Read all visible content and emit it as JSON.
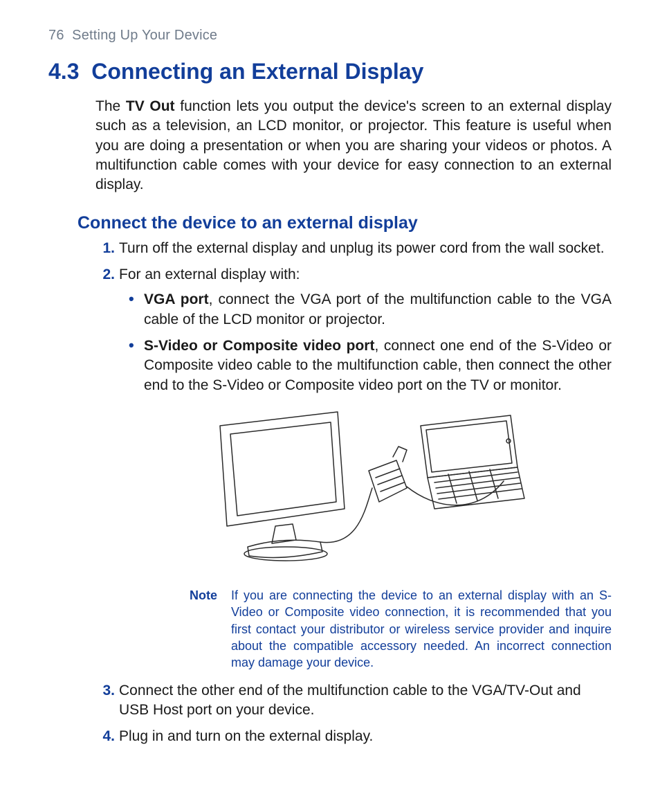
{
  "page_number": "76",
  "chapter_title": "Setting Up Your Device",
  "section_number": "4.3",
  "section_title": "Connecting an External Display",
  "intro_pre": "The ",
  "intro_bold": "TV Out",
  "intro_post": " function lets you output the device's screen to an external display such as a television, an LCD monitor, or projector. This feature is useful when you are doing a presentation or when you are sharing your videos or photos. A multifunction cable comes with your device for easy connection to an external display.",
  "subheading": "Connect the device to an external display",
  "steps": {
    "s1": {
      "num": "1.",
      "text": "Turn off the external display and unplug its power cord from the wall socket."
    },
    "s2": {
      "num": "2.",
      "text": "For an external display with:"
    },
    "s2_sub": {
      "a_bold": "VGA port",
      "a_text": ", connect the VGA port of the multifunction cable to the VGA cable of the LCD monitor or projector.",
      "b_bold": "S-Video or Composite video port",
      "b_text": ", connect one end of the S-Video or Composite video cable to the multifunction cable, then connect the other end to the S-Video or Composite video port on the TV or monitor."
    },
    "s3": {
      "num": "3.",
      "text": "Connect the other end of the multifunction cable to the VGA/TV-Out and USB Host port on your device."
    },
    "s4": {
      "num": "4.",
      "text": "Plug in and turn on the external display."
    }
  },
  "note": {
    "label": "Note",
    "text": "If you are connecting the device to an external display with an S-Video or Composite video connection, it is recommended that you first contact your distributor or wireless service provider and inquire about the compatible accessory needed. An incorrect connection may damage your device."
  },
  "figure_alt": "Line drawing of an LCD monitor connected by cable to a handheld device with keyboard"
}
